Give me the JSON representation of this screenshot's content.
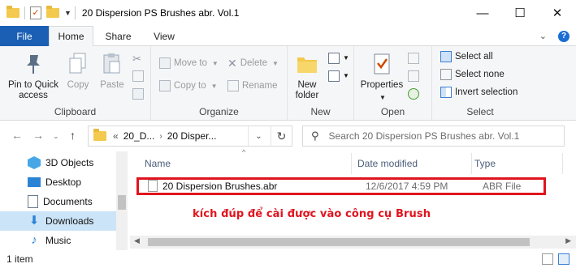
{
  "window": {
    "title": "20 Dispersion PS Brushes abr. Vol.1",
    "controls": {
      "minimize": "—",
      "maximize": "☐",
      "close": "✕"
    }
  },
  "tabs": {
    "file": "File",
    "home": "Home",
    "share": "Share",
    "view": "View"
  },
  "ribbon": {
    "clipboard": {
      "label": "Clipboard",
      "pin_line1": "Pin to Quick",
      "pin_line2": "access",
      "copy": "Copy",
      "paste": "Paste"
    },
    "organize": {
      "label": "Organize",
      "move_to": "Move to",
      "copy_to": "Copy to",
      "delete": "Delete",
      "rename": "Rename"
    },
    "new": {
      "label": "New",
      "new_folder_line1": "New",
      "new_folder_line2": "folder"
    },
    "open": {
      "label": "Open",
      "properties": "Properties"
    },
    "select": {
      "label": "Select",
      "select_all": "Select all",
      "select_none": "Select none",
      "invert_selection": "Invert selection"
    }
  },
  "address": {
    "overflow": "«",
    "crumb1": "20_D...",
    "crumb2": "20 Disper...",
    "search_placeholder": "Search 20 Dispersion PS Brushes abr. Vol.1"
  },
  "nav": {
    "items": [
      {
        "label": "3D Objects",
        "icon": "3d-objects-icon"
      },
      {
        "label": "Desktop",
        "icon": "desktop-icon"
      },
      {
        "label": "Documents",
        "icon": "documents-icon"
      },
      {
        "label": "Downloads",
        "icon": "downloads-icon",
        "selected": true
      },
      {
        "label": "Music",
        "icon": "music-icon"
      }
    ]
  },
  "columns": {
    "name": "Name",
    "date": "Date modified",
    "type": "Type"
  },
  "files": [
    {
      "name": "20 Dispersion Brushes.abr",
      "date": "12/6/2017 4:59 PM",
      "type": "ABR File"
    }
  ],
  "annotation": "kích đúp để cài được vào công cụ Brush",
  "status": {
    "item_count": "1 item"
  },
  "colors": {
    "file_tab": "#1a5fb4",
    "selection": "#cce4f7",
    "annotation_red": "#e0141e",
    "folder_yellow": "#f3c94e"
  }
}
